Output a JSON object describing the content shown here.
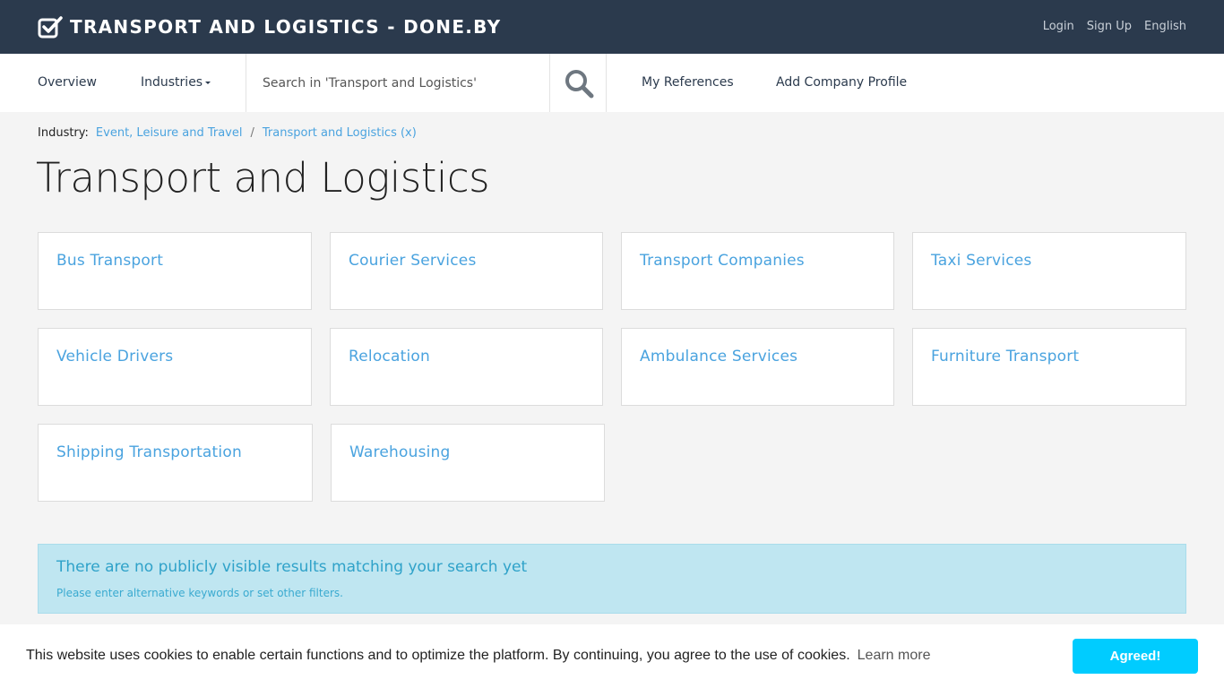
{
  "header": {
    "brand": "TRANSPORT AND LOGISTICS - DONE.BY",
    "links": [
      "Login",
      "Sign Up",
      "English"
    ]
  },
  "nav": {
    "overview": "Overview",
    "industries": "Industries",
    "search_placeholder": "Search in 'Transport and Logistics'",
    "my_references": "My References",
    "add_company": "Add Company Profile"
  },
  "breadcrumb": {
    "label": "Industry:",
    "items": [
      "Event, Leisure and Travel",
      "Transport and Logistics (x)"
    ],
    "separator": "/"
  },
  "page_title": "Transport and Logistics",
  "categories": [
    "Bus Transport",
    "Courier Services",
    "Transport Companies",
    "Taxi Services",
    "Vehicle Drivers",
    "Relocation",
    "Ambulance Services",
    "Furniture Transport",
    "Shipping Transportation",
    "Warehousing"
  ],
  "alert": {
    "title": "There are no publicly visible results matching your search yet",
    "text": "Please enter alternative keywords or set other filters."
  },
  "cookie": {
    "text": "This website uses cookies to enable certain functions and to optimize the platform. By continuing, you agree to the use of cookies.",
    "learn_more": "Learn more",
    "button": "Agreed!"
  },
  "colors": {
    "topbar": "#2b3a4d",
    "link": "#4aa3df",
    "alert_bg": "#bfe6f1",
    "cookie_button": "#00ccff"
  },
  "icons": [
    "checkbox-check-icon",
    "search-icon",
    "caret-down-icon"
  ]
}
